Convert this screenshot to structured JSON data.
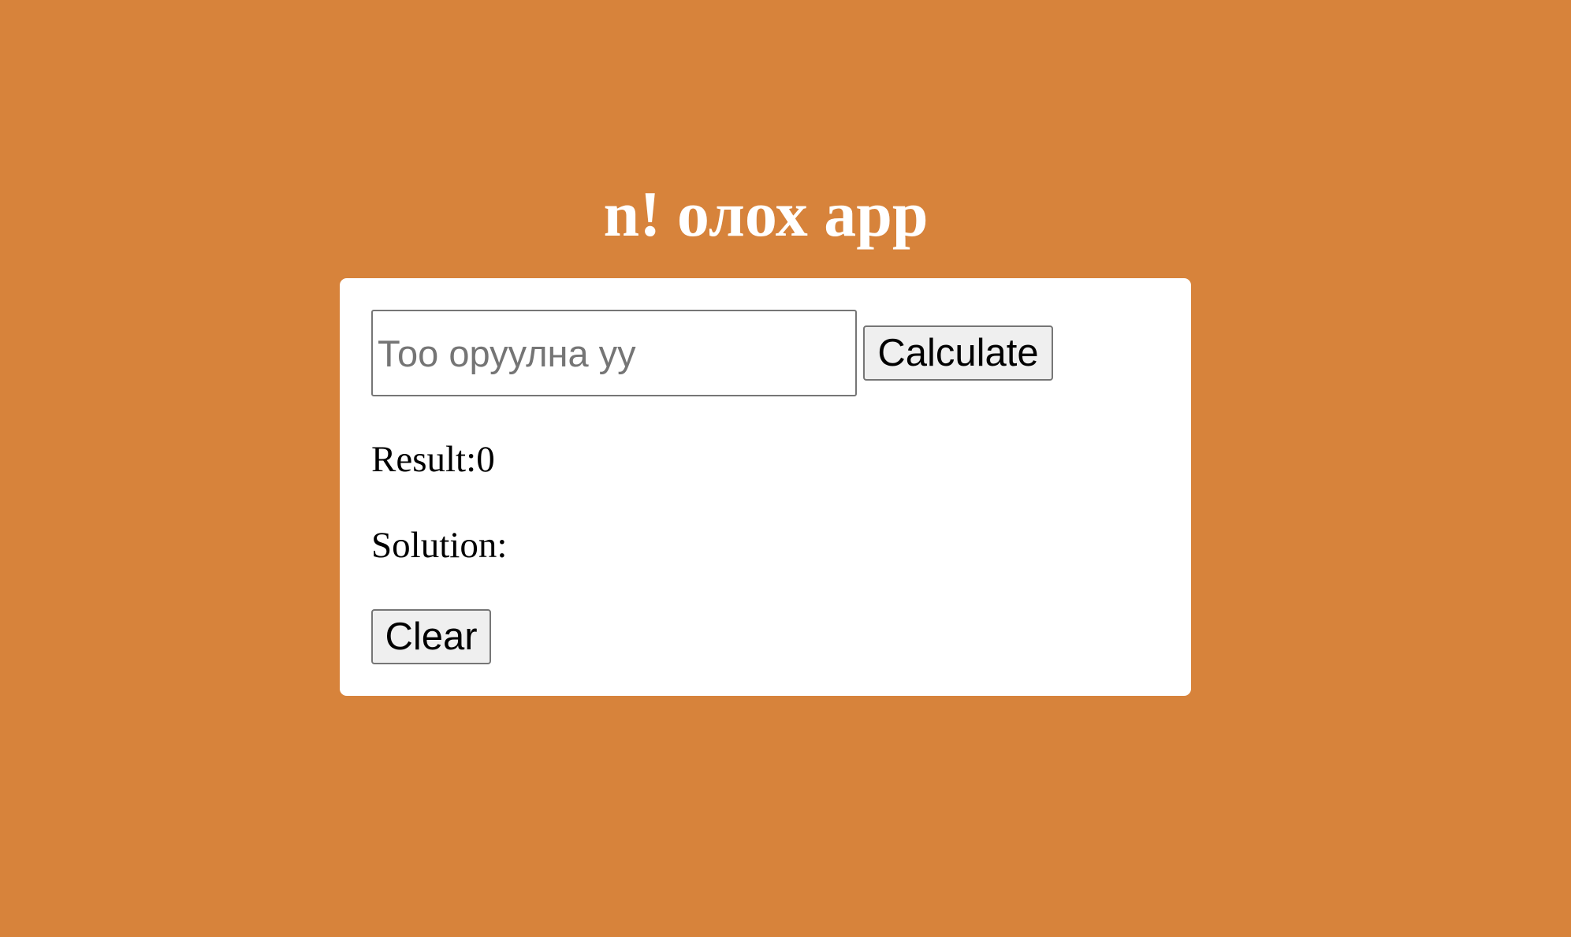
{
  "app": {
    "title": "n! олох app",
    "background_color": "#d7833b",
    "card_color": "#ffffff"
  },
  "form": {
    "input": {
      "placeholder": "Тоо оруулна уу",
      "value": ""
    },
    "calculate_label": "Calculate",
    "clear_label": "Clear"
  },
  "output": {
    "result_label": "Result:",
    "result_value": "0",
    "solution_label": "Solution:",
    "solution_value": ""
  }
}
